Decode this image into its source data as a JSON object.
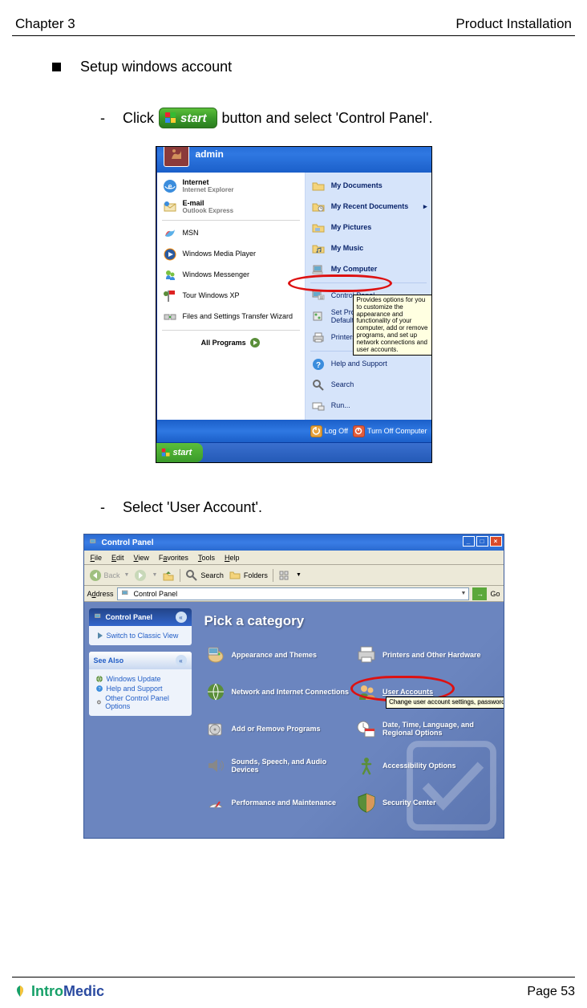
{
  "header": {
    "chapter": "Chapter 3",
    "title": "Product Installation"
  },
  "bullet": "Setup windows account",
  "step1": {
    "prefix": "Click",
    "start_label": "start",
    "suffix": "button and select 'Control Panel'."
  },
  "step2": "Select 'User Account'.",
  "start_menu": {
    "user": "admin",
    "left": {
      "internet": "Internet",
      "internet_sub": "Internet Explorer",
      "email": "E-mail",
      "email_sub": "Outlook Express",
      "msn": "MSN",
      "wmp": "Windows Media Player",
      "wm": "Windows Messenger",
      "tour": "Tour Windows XP",
      "fst": "Files and Settings Transfer Wizard",
      "all": "All Programs"
    },
    "right": {
      "docs": "My Documents",
      "recent": "My Recent Documents",
      "pics": "My Pictures",
      "music": "My Music",
      "comp": "My Computer",
      "cp": "Control Panel",
      "spad": "Set Program Access and Defaults",
      "pf": "Printers and Faxes",
      "help": "Help and Support",
      "search": "Search",
      "run": "Run..."
    },
    "tooltip": "Provides options for you to customize the appearance and functionality of your computer, add or remove programs, and set up network connections and user accounts.",
    "logoff": "Log Off",
    "turnoff": "Turn Off Computer",
    "taskbar_start": "start"
  },
  "control_panel": {
    "title": "Control Panel",
    "menu": {
      "file": "File",
      "edit": "Edit",
      "view": "View",
      "fav": "Favorites",
      "tools": "Tools",
      "help": "Help"
    },
    "toolbar": {
      "back": "Back",
      "search": "Search",
      "folders": "Folders"
    },
    "addr_label": "Address",
    "addr_value": "Control Panel",
    "go": "Go",
    "side_cp": "Control Panel",
    "switch": "Switch to Classic View",
    "see_also": "See Also",
    "see_items": [
      "Windows Update",
      "Help and Support",
      "Other Control Panel Options"
    ],
    "pick": "Pick a category",
    "cats": [
      "Appearance and Themes",
      "Printers and Other Hardware",
      "Network and Internet Connections",
      "User Accounts",
      "Add or Remove Programs",
      "Date, Time, Language, and Regional Options",
      "Sounds, Speech, and Audio Devices",
      "Accessibility Options",
      "Performance and Maintenance",
      "Security Center"
    ],
    "ua_tip": "Change user account settings, passwords"
  },
  "footer": {
    "brand1": "Intro",
    "brand2": "Medic",
    "page": "Page 53"
  }
}
